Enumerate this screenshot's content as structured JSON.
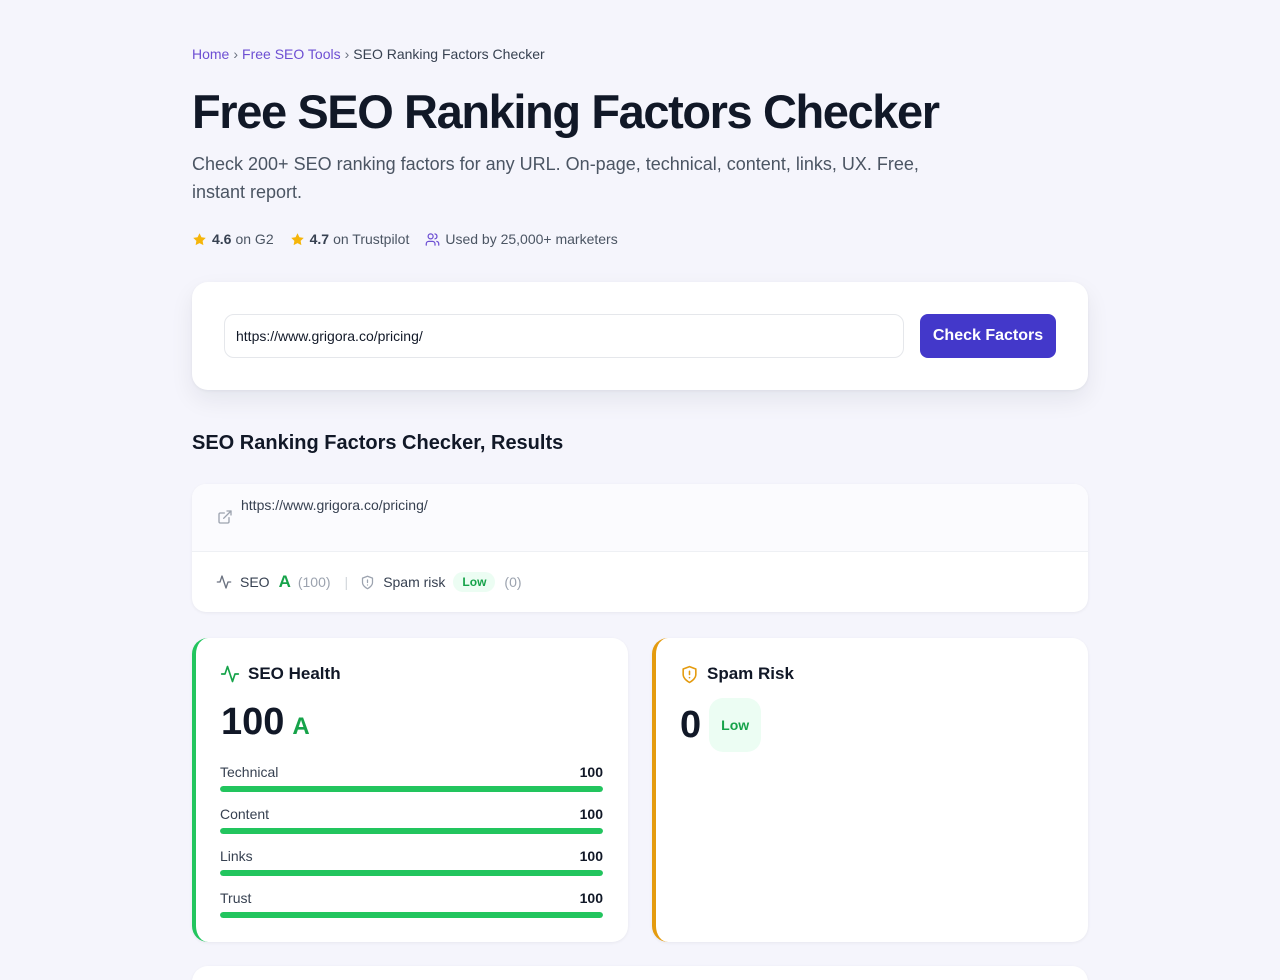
{
  "breadcrumb": {
    "home": "Home",
    "tools": "Free SEO Tools",
    "current": "SEO Ranking Factors Checker",
    "separator": "›"
  },
  "page_title": "Free SEO Ranking Factors Checker",
  "subtitle": "Check 200+ SEO ranking factors for any URL. On-page, technical, content, links, UX. Free, instant report.",
  "ratings": {
    "g2_score": "4.6",
    "g2_label": "on G2",
    "trustpilot_score": "4.7",
    "trustpilot_label": "on Trustpilot",
    "users": "Used by 25,000+ marketers"
  },
  "search": {
    "value": "https://www.grigora.co/pricing/",
    "button_label": "Check Factors"
  },
  "results_heading": "SEO Ranking Factors Checker, Results",
  "summary": {
    "url": "https://www.grigora.co/pricing/",
    "seo_label": "SEO",
    "seo_grade": "A",
    "seo_score": "(100)",
    "separator": "|",
    "spam_label": "Spam risk",
    "spam_level": "Low",
    "spam_score": "(0)"
  },
  "seo_health": {
    "title": "SEO Health",
    "score": "100",
    "grade": "A",
    "metrics": [
      {
        "label": "Technical",
        "value": "100",
        "percent": 100
      },
      {
        "label": "Content",
        "value": "100",
        "percent": 100
      },
      {
        "label": "Links",
        "value": "100",
        "percent": 100
      },
      {
        "label": "Trust",
        "value": "100",
        "percent": 100
      }
    ]
  },
  "spam_risk": {
    "title": "Spam Risk",
    "score": "0",
    "level": "Low"
  },
  "colors": {
    "accent": "#4338ca",
    "link": "#6d4fd3",
    "success": "#22c55e",
    "grade_green": "#16a34a",
    "warning": "#e49b0f",
    "star": "#f5b50a",
    "background": "#f5f5fc"
  },
  "icons": {
    "star": "star-icon",
    "users": "users-icon",
    "external_link": "external-link-icon",
    "activity": "activity-icon",
    "shield": "shield-icon",
    "shield_alert": "shield-alert-icon"
  }
}
